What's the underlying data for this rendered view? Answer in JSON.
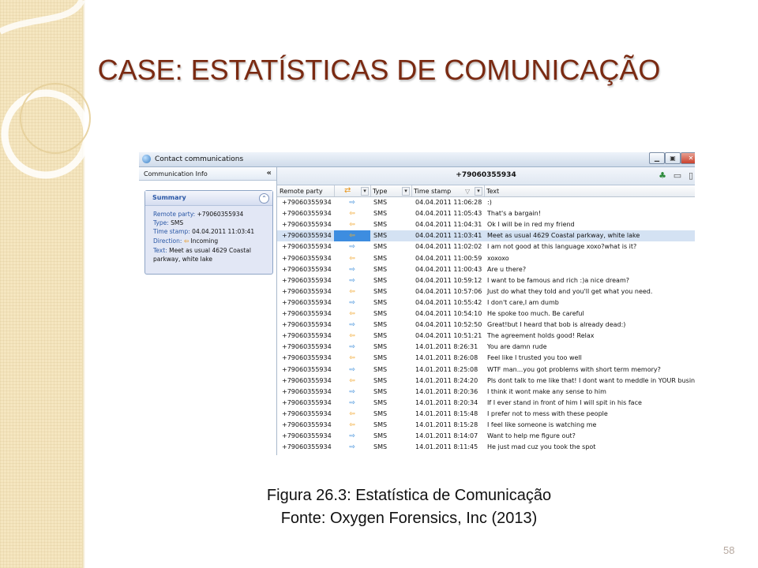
{
  "slide": {
    "title": "CASE: ESTATÍSTICAS DE COMUNICAÇÃO",
    "caption_line1": "Figura 26.3:  Estatística de Comunicação",
    "caption_line2": "Fonte: Oxygen Forensics, Inc (2013)",
    "page_number": "58",
    "title_color": "#7a2a12"
  },
  "window": {
    "title": "Contact communications",
    "icons": [
      "app-icon",
      "minimize-icon",
      "restore-icon",
      "close-icon"
    ]
  },
  "left_pane": {
    "header": "Communication Info",
    "collapse_glyph": "«",
    "summary": {
      "title": "Summary",
      "remote_party_label": "Remote party:",
      "remote_party_value": "+79060355934",
      "type_label": "Type:",
      "type_value": "SMS",
      "timestamp_label": "Time stamp:",
      "timestamp_value": "04.04.2011 11:03:41",
      "direction_label": "Direction:",
      "direction_value": "Incoming",
      "text_label": "Text:",
      "text_value_line1": "Meet as usual 4629 Coastal",
      "text_value_line2": "parkway, white lake"
    }
  },
  "right_pane": {
    "phone_number": "+79060355934",
    "columns": [
      "Remote party",
      "",
      "Type",
      "Time stamp",
      "Text"
    ],
    "rows": [
      {
        "party": "+79060355934",
        "dir": "out",
        "type": "SMS",
        "time": "04.04.2011 11:06:28",
        "text": ":)"
      },
      {
        "party": "+79060355934",
        "dir": "in",
        "type": "SMS",
        "time": "04.04.2011 11:05:43",
        "text": "That's a bargain!"
      },
      {
        "party": "+79060355934",
        "dir": "in",
        "type": "SMS",
        "time": "04.04.2011 11:04:31",
        "text": "Ok I will be in red my friend"
      },
      {
        "party": "+79060355934",
        "dir": "in",
        "type": "SMS",
        "time": "04.04.2011 11:03:41",
        "text": "Meet as usual 4629 Coastal parkway, white lake",
        "selected": true
      },
      {
        "party": "+79060355934",
        "dir": "out",
        "type": "SMS",
        "time": "04.04.2011 11:02:02",
        "text": "I am not good at this language xoxo?what is it?"
      },
      {
        "party": "+79060355934",
        "dir": "in",
        "type": "SMS",
        "time": "04.04.2011 11:00:59",
        "text": " xoxoxo"
      },
      {
        "party": "+79060355934",
        "dir": "out",
        "type": "SMS",
        "time": "04.04.2011 11:00:43",
        "text": "Are u there?"
      },
      {
        "party": "+79060355934",
        "dir": "out",
        "type": "SMS",
        "time": "04.04.2011 10:59:12",
        "text": "I want to be famous and rich :)a nice dream?"
      },
      {
        "party": "+79060355934",
        "dir": "in",
        "type": "SMS",
        "time": "04.04.2011 10:57:06",
        "text": "Just do what they told and you'll get what you need."
      },
      {
        "party": "+79060355934",
        "dir": "out",
        "type": "SMS",
        "time": "04.04.2011 10:55:42",
        "text": "I don't care,I am dumb"
      },
      {
        "party": "+79060355934",
        "dir": "in",
        "type": "SMS",
        "time": "04.04.2011 10:54:10",
        "text": "He spoke too much. Be careful"
      },
      {
        "party": "+79060355934",
        "dir": "out",
        "type": "SMS",
        "time": "04.04.2011 10:52:50",
        "text": "Great!but I heard that bob is already dead:)"
      },
      {
        "party": "+79060355934",
        "dir": "in",
        "type": "SMS",
        "time": "04.04.2011 10:51:21",
        "text": "The agreement holds good! Relax"
      },
      {
        "party": "+79060355934",
        "dir": "out",
        "type": "SMS",
        "time": "14.01.2011 8:26:31",
        "text": "You are damn rude"
      },
      {
        "party": "+79060355934",
        "dir": "in",
        "type": "SMS",
        "time": "14.01.2011 8:26:08",
        "text": "Feel like I trusted you too well"
      },
      {
        "party": "+79060355934",
        "dir": "out",
        "type": "SMS",
        "time": "14.01.2011 8:25:08",
        "text": "WTF man...you got problems with short term memory?"
      },
      {
        "party": "+79060355934",
        "dir": "in",
        "type": "SMS",
        "time": "14.01.2011 8:24:20",
        "text": "Pls dont talk to me like that! I dont want to meddle in YOUR business"
      },
      {
        "party": "+79060355934",
        "dir": "out",
        "type": "SMS",
        "time": "14.01.2011 8:20:36",
        "text": "I think it wont make any sense to him"
      },
      {
        "party": "+79060355934",
        "dir": "out",
        "type": "SMS",
        "time": "14.01.2011 8:20:34",
        "text": "If I ever stand in front of him I will spit in his face"
      },
      {
        "party": "+79060355934",
        "dir": "in",
        "type": "SMS",
        "time": "14.01.2011 8:15:48",
        "text": "I prefer not to mess with these people"
      },
      {
        "party": "+79060355934",
        "dir": "in",
        "type": "SMS",
        "time": "14.01.2011 8:15:28",
        "text": "I feel like someone is watching me"
      },
      {
        "party": "+79060355934",
        "dir": "out",
        "type": "SMS",
        "time": "14.01.2011 8:14:07",
        "text": "Want to help me figure out?"
      },
      {
        "party": "+79060355934",
        "dir": "out",
        "type": "SMS",
        "time": "14.01.2011 8:11:45",
        "text": "He just mad cuz you took the spot"
      }
    ]
  },
  "colors": {
    "incoming_arrow": "#f0a020",
    "outgoing_arrow": "#2f86d8",
    "selected_row": "#d4e2f3",
    "band": "#f5e6c0"
  }
}
